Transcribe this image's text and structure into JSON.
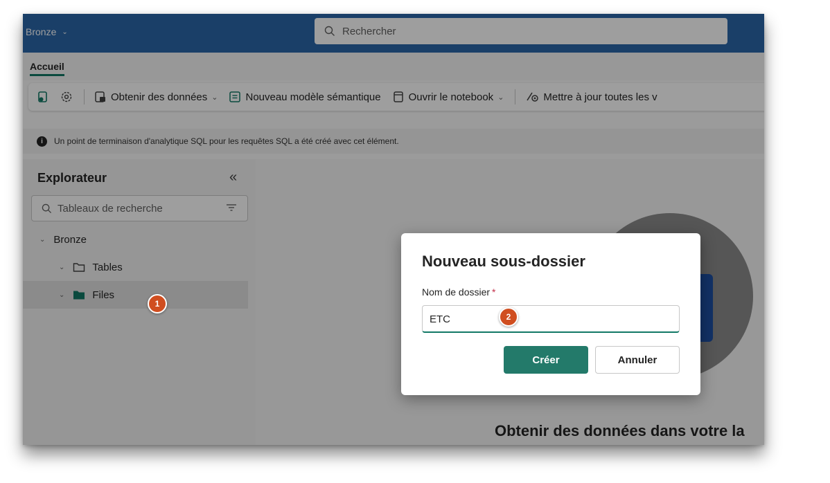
{
  "topbar": {
    "workspace_label": "Bronze",
    "search_placeholder": "Rechercher",
    "background_color": "#2b66a8"
  },
  "tabs": {
    "home_label": "Accueil"
  },
  "toolbar": {
    "get_data_label": "Obtenir des données",
    "new_semantic_model_label": "Nouveau modèle sémantique",
    "open_notebook_label": "Ouvrir le notebook",
    "refresh_all_label": "Mettre à jour toutes les v",
    "icons": [
      "new-item-icon",
      "settings-icon",
      "get-data-icon",
      "semantic-model-icon",
      "notebook-icon",
      "refresh-icon"
    ]
  },
  "info_bar": {
    "message": "Un point de terminaison d'analytique SQL pour les requêtes SQL a été créé avec cet élément."
  },
  "explorer": {
    "title": "Explorateur",
    "search_placeholder": "Tableaux de recherche",
    "tree": {
      "root": "Bronze",
      "tables": "Tables",
      "files": "Files"
    }
  },
  "main": {
    "heading": "Obtenir des données dans votre la"
  },
  "dialog": {
    "title": "Nouveau sous-dossier",
    "folder_label": "Nom de dossier",
    "required_marker": "*",
    "folder_value": "ETC",
    "create_label": "Créer",
    "cancel_label": "Annuler",
    "primary_color": "#237a6a"
  },
  "annotations": {
    "step1": "1",
    "step2": "2",
    "badge_color": "#d04e20"
  }
}
